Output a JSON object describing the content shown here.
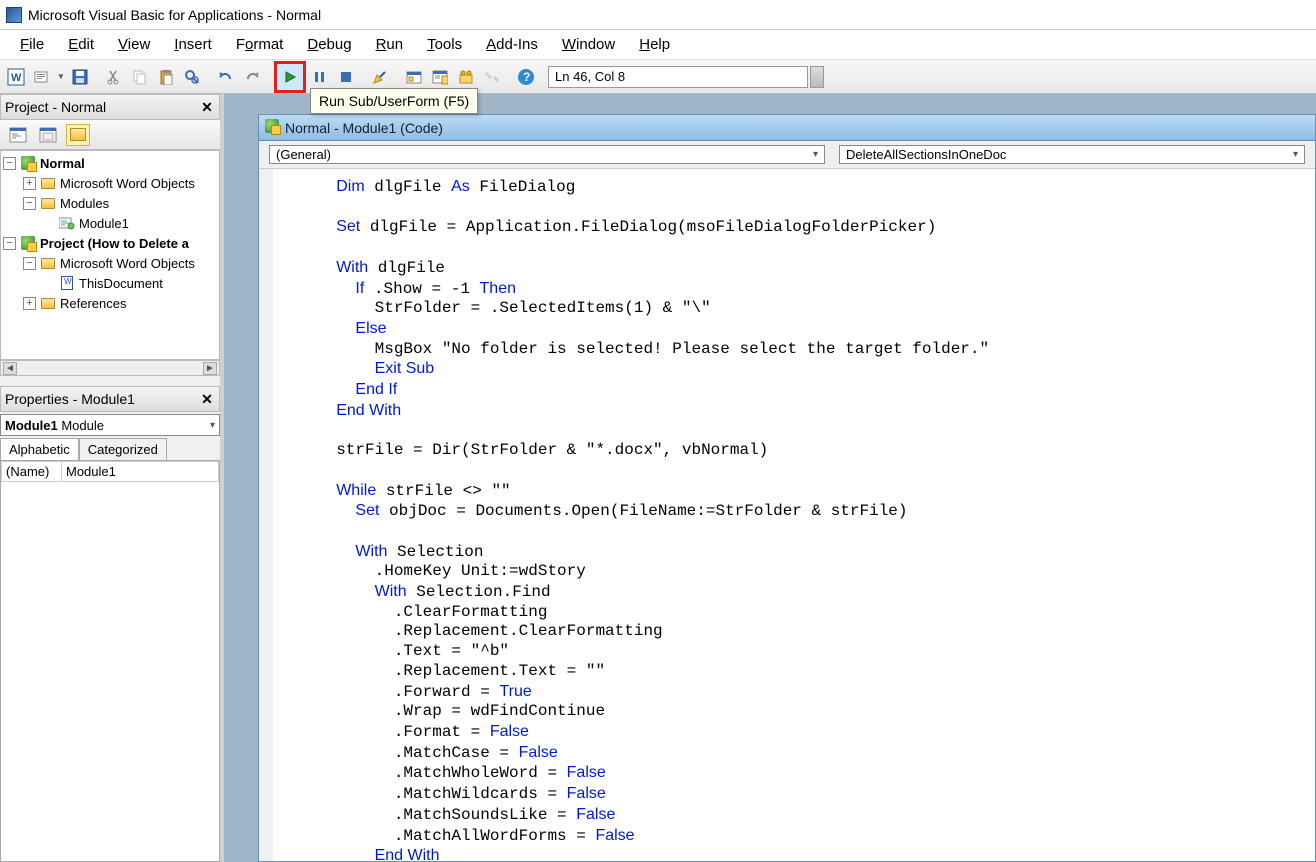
{
  "title": "Microsoft Visual Basic for Applications - Normal",
  "menus": [
    "File",
    "Edit",
    "View",
    "Insert",
    "Format",
    "Debug",
    "Run",
    "Tools",
    "Add-Ins",
    "Window",
    "Help"
  ],
  "tooltip": "Run Sub/UserForm (F5)",
  "status": "Ln 46, Col 8",
  "project_panel": {
    "title": "Project - Normal",
    "nodes": {
      "normal": "Normal",
      "mwo1": "Microsoft Word Objects",
      "modules": "Modules",
      "module1": "Module1",
      "proj2": "Project (How to Delete a",
      "mwo2": "Microsoft Word Objects",
      "thisdoc": "ThisDocument",
      "refs": "References"
    }
  },
  "properties_panel": {
    "title": "Properties - Module1",
    "combo_bold": "Module1",
    "combo_rest": " Module",
    "tabs": [
      "Alphabetic",
      "Categorized"
    ],
    "row_name": "(Name)",
    "row_val": "Module1"
  },
  "mdi": {
    "title": "Normal - Module1 (Code)",
    "left_combo": "(General)",
    "right_combo": "DeleteAllSectionsInOneDoc"
  },
  "code_tokens": [
    [
      "  ",
      [
        "kw",
        "Dim"
      ],
      " dlgFile ",
      [
        "kw",
        "As"
      ],
      " FileDialog"
    ],
    [
      ""
    ],
    [
      "  ",
      [
        "kw",
        "Set"
      ],
      " dlgFile = Application.FileDialog(msoFileDialogFolderPicker)"
    ],
    [
      ""
    ],
    [
      "  ",
      [
        "kw",
        "With"
      ],
      " dlgFile"
    ],
    [
      "    ",
      [
        "kw",
        "If"
      ],
      " .Show = -1 ",
      [
        "kw",
        "Then"
      ]
    ],
    [
      "      StrFolder = .SelectedItems(1) & \"\\\""
    ],
    [
      "    ",
      [
        "kw",
        "Else"
      ]
    ],
    [
      "      MsgBox \"No folder is selected! Please select the target folder.\""
    ],
    [
      "      ",
      [
        "kw",
        "Exit Sub"
      ]
    ],
    [
      "    ",
      [
        "kw",
        "End If"
      ]
    ],
    [
      "  ",
      [
        "kw",
        "End With"
      ]
    ],
    [
      ""
    ],
    [
      "  strFile = Dir(StrFolder & \"*.docx\", vbNormal)"
    ],
    [
      ""
    ],
    [
      "  ",
      [
        "kw",
        "While"
      ],
      " strFile <> \"\""
    ],
    [
      "    ",
      [
        "kw",
        "Set"
      ],
      " objDoc = Documents.Open(FileName:=StrFolder & strFile)"
    ],
    [
      ""
    ],
    [
      "    ",
      [
        "kw",
        "With"
      ],
      " Selection"
    ],
    [
      "      .HomeKey Unit:=wdStory"
    ],
    [
      "      ",
      [
        "kw",
        "With"
      ],
      " Selection.Find"
    ],
    [
      "        .ClearFormatting"
    ],
    [
      "        .Replacement.ClearFormatting"
    ],
    [
      "        .Text = \"^b\""
    ],
    [
      "        .Replacement.Text = \"\""
    ],
    [
      "        .Forward = ",
      [
        "kw",
        "True"
      ]
    ],
    [
      "        .Wrap = wdFindContinue"
    ],
    [
      "        .Format = ",
      [
        "kw",
        "False"
      ]
    ],
    [
      "        .MatchCase = ",
      [
        "kw",
        "False"
      ]
    ],
    [
      "        .MatchWholeWord = ",
      [
        "kw",
        "False"
      ]
    ],
    [
      "        .MatchWildcards = ",
      [
        "kw",
        "False"
      ]
    ],
    [
      "        .MatchSoundsLike = ",
      [
        "kw",
        "False"
      ]
    ],
    [
      "        .MatchAllWordForms = ",
      [
        "kw",
        "False"
      ]
    ],
    [
      "      ",
      [
        "kw",
        "End With"
      ]
    ]
  ]
}
